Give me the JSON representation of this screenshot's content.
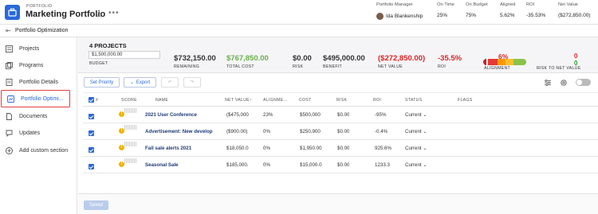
{
  "header": {
    "type_label": "PORTFOLIO",
    "title": "Marketing Portfolio",
    "star_icon": "star-icon",
    "more_icon": "more-dots-icon",
    "manager_label": "Portfolio Manager",
    "manager_name": "Ida Blankenship",
    "on_time_label": "On Time",
    "on_time_value": "25%",
    "on_budget_label": "On Budget",
    "on_budget_value": "75%",
    "aligned_label": "Aligned",
    "aligned_value": "5.62%",
    "roi_label": "ROI",
    "roi_value": "-35.53%",
    "net_value_label": "Net Value",
    "net_value_value": "($272,850.00)"
  },
  "subheader": {
    "title": "Portfolio Optimization"
  },
  "sidebar": {
    "items": [
      {
        "label": "Projects",
        "icon": "projects-icon"
      },
      {
        "label": "Programs",
        "icon": "programs-icon"
      },
      {
        "label": "Portfolio Details",
        "icon": "details-icon"
      },
      {
        "label": "Portfolio Optimi...",
        "icon": "optimization-icon"
      },
      {
        "label": "Documents",
        "icon": "documents-icon"
      },
      {
        "label": "Updates",
        "icon": "updates-icon"
      },
      {
        "label": "Add custom section",
        "icon": "plus-circle-icon"
      }
    ]
  },
  "summary": {
    "project_count": "4 PROJECTS",
    "budget_value": "$1,500,000.00",
    "budget_label": "BUDGET",
    "remaining_value": "$732,150.00",
    "remaining_label": "REMAINING",
    "total_cost_value": "$767,850.00",
    "total_cost_label": "TOTAL COST",
    "risk_value": "$0.00",
    "risk_label": "RISK",
    "benefit_value": "$495,000.00",
    "benefit_label": "BENEFIT",
    "net_value_value": "($272,850.00)",
    "net_value_label": "NET VALUE",
    "roi_value": "-35.5%",
    "roi_label": "ROI",
    "alignment_value": "6%",
    "alignment_label": "ALIGNMENT",
    "risk_net_top": "0",
    "risk_net_bottom": "0",
    "risk_net_label": "RISK TO NET VALUE",
    "colors": {
      "green": "#2a9a2a",
      "red": "#d22222",
      "blue": "#2969d9"
    }
  },
  "toolbar": {
    "set_priority": "Set Priority",
    "export": "Export",
    "undo_icon": "undo-icon",
    "redo_icon": "redo-icon",
    "columns_icon": "sliders-icon",
    "settings_icon": "gear-icon"
  },
  "table": {
    "headers": {
      "number": "#",
      "score": "SCORE",
      "name": "NAME",
      "net_value": "NET VALUE",
      "alignment": "ALIGNME...",
      "cost": "COST",
      "risk": "RISK",
      "roi": "ROI",
      "status": "STATUS",
      "flags": "FLAGS"
    },
    "rows": [
      {
        "name": "2021 User Conference",
        "net_value": "($475,000",
        "alignment": "23%",
        "cost": "$500,000",
        "risk": "$0.00",
        "roi": "-95%",
        "status": "Current"
      },
      {
        "name": "Advertisement: New develop",
        "net_value": "($900.00)",
        "alignment": "0%",
        "cost": "$250,900",
        "risk": "$0.00",
        "roi": "-0.4%",
        "status": "Current"
      },
      {
        "name": "Fall sale alerts 2021",
        "net_value": "$18,050.0",
        "alignment": "0%",
        "cost": "$1,950.00",
        "risk": "$0.00",
        "roi": "925.6%",
        "status": "Current"
      },
      {
        "name": "Seasonal Sale",
        "net_value": "$185,000.",
        "alignment": "0%",
        "cost": "$15,000.0",
        "risk": "$0.00",
        "roi": "1233.3",
        "status": "Current"
      }
    ]
  },
  "footer": {
    "save_label": "Saved"
  }
}
